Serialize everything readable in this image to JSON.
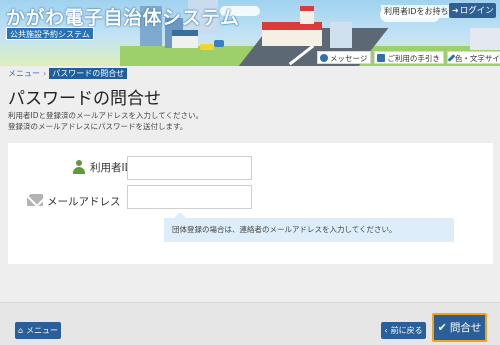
{
  "header": {
    "site_title": "かがわ電子自治体システム",
    "site_subtitle": "公共施設予約システム",
    "forgot_id_link": "利用者IDをお持ちの方",
    "login_button": "ログイン",
    "links": [
      {
        "label": "メッセージ",
        "icon": "speech-bubble-icon"
      },
      {
        "label": "ご利用の手引き",
        "icon": "book-icon"
      },
      {
        "label": "色・文字サイズ変更",
        "icon": "brush-icon"
      }
    ]
  },
  "breadcrumb": {
    "home": "メニュー",
    "separator": "›",
    "current": "パスワードの問合せ"
  },
  "page": {
    "title": "パスワードの問合せ",
    "desc_line1": "利用者IDと登録済のメールアドレスを入力してください。",
    "desc_line2": "登録済のメールアドレスにパスワードを送付します。"
  },
  "form": {
    "user_id_label": "利用者ID",
    "user_id_value": "",
    "email_label": "メールアドレス",
    "email_value": "",
    "hint": "団体登録の場合は、連絡者のメールアドレスを入力してください。"
  },
  "footer": {
    "menu_button": "メニュー",
    "back_button": "前に戻る",
    "submit_button": "問合せ"
  },
  "colors": {
    "primary": "#2a5f9a",
    "accent_border": "#f2a21b",
    "breadcrumb_current_bg": "#1f5f9e",
    "hint_bg": "#ddeefa",
    "user_icon": "#5d9b3c"
  }
}
